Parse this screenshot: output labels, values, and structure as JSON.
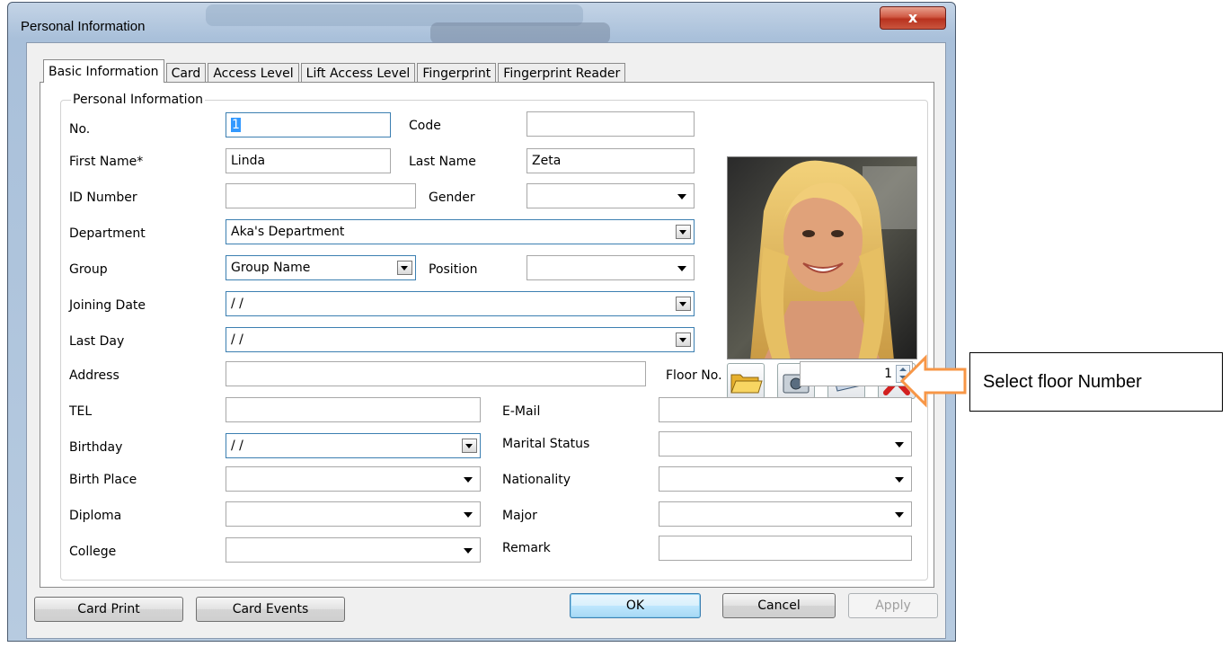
{
  "window": {
    "title": "Personal Information",
    "close_glyph": "x"
  },
  "tabs": [
    "Basic Information",
    "Card",
    "Access Level",
    "Lift Access Level",
    "Fingerprint",
    "Fingerprint Reader"
  ],
  "group_title": "Personal Information",
  "fields": {
    "no": {
      "label": "No.",
      "value": "1"
    },
    "code": {
      "label": "Code",
      "value": ""
    },
    "first_name": {
      "label": "First Name*",
      "value": "Linda"
    },
    "last_name": {
      "label": "Last Name",
      "value": "Zeta"
    },
    "id_number": {
      "label": "ID Number",
      "value": ""
    },
    "gender": {
      "label": "Gender",
      "value": ""
    },
    "department": {
      "label": "Department",
      "value": "Aka's Department"
    },
    "group": {
      "label": "Group",
      "value": "Group Name"
    },
    "position": {
      "label": "Position",
      "value": ""
    },
    "joining_date": {
      "label": "Joining Date",
      "value": "/ /"
    },
    "last_day": {
      "label": "Last Day",
      "value": "/ /"
    },
    "address": {
      "label": "Address",
      "value": ""
    },
    "floor_no": {
      "label": "Floor No.",
      "value": "1"
    },
    "tel": {
      "label": "TEL",
      "value": ""
    },
    "email": {
      "label": "E-Mail",
      "value": ""
    },
    "birthday": {
      "label": "Birthday",
      "value": "/ /"
    },
    "marital_status": {
      "label": "Marital Status",
      "value": ""
    },
    "birth_place": {
      "label": "Birth Place",
      "value": ""
    },
    "nationality": {
      "label": "Nationality",
      "value": ""
    },
    "diploma": {
      "label": "Diploma",
      "value": ""
    },
    "major": {
      "label": "Major",
      "value": ""
    },
    "college": {
      "label": "College",
      "value": ""
    },
    "remark": {
      "label": "Remark",
      "value": ""
    }
  },
  "photo_buttons": [
    "folder-icon",
    "camera-icon",
    "scanner-icon",
    "delete-icon"
  ],
  "buttons": {
    "card_print": "Card Print",
    "card_events": "Card Events",
    "ok": "OK",
    "cancel": "Cancel",
    "apply": "Apply"
  },
  "callout": {
    "text": "Select floor Number",
    "arrow_color": "#f79646"
  },
  "colors": {
    "title_bar": "#b7cbe0",
    "close_button": "#c9553e",
    "focus_border": "#3c7fb1",
    "selection": "#3399ff"
  }
}
